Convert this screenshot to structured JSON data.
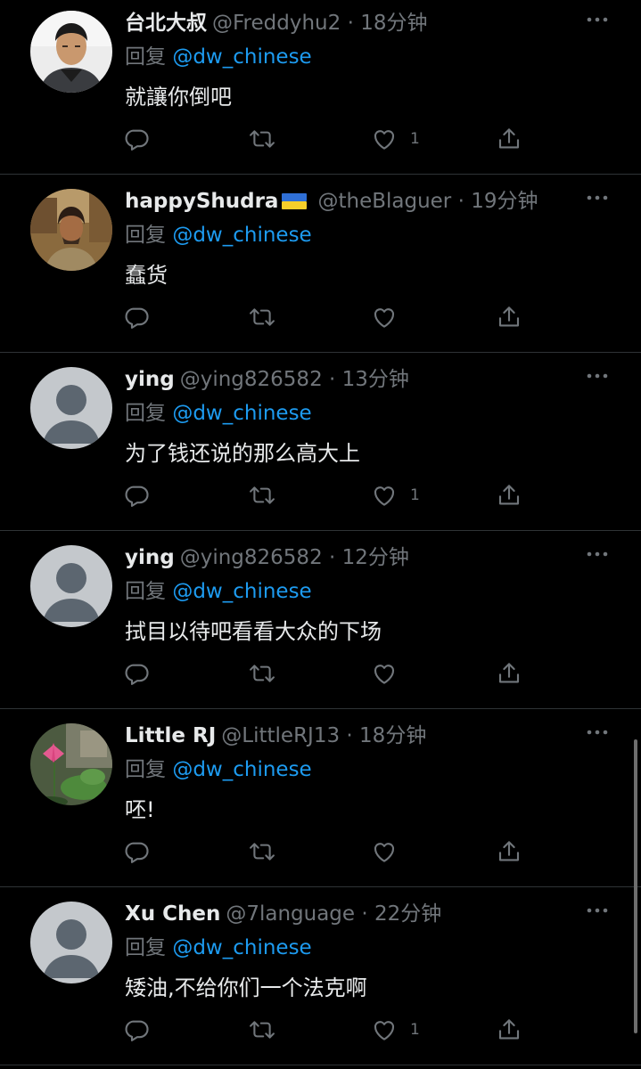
{
  "reply_prefix": "回复",
  "separator": "·",
  "tweets": [
    {
      "name": "台北大叔",
      "handle": "@Freddyhu2",
      "time": "18分钟",
      "mention": "@dw_chinese",
      "text": "就讓你倒吧",
      "likes": "1",
      "avatar": "photo-man"
    },
    {
      "name": "happyShudra",
      "handle": "@theBlaguer",
      "time": "19分钟",
      "mention": "@dw_chinese",
      "text": "蠢货",
      "likes": "",
      "avatar": "photo-man-outdoor",
      "flag": "ukraine-flag"
    },
    {
      "name": "ying",
      "handle": "@ying826582",
      "time": "13分钟",
      "mention": "@dw_chinese",
      "text": "为了钱还说的那么高大上",
      "likes": "1",
      "avatar": "default"
    },
    {
      "name": "ying",
      "handle": "@ying826582",
      "time": "12分钟",
      "mention": "@dw_chinese",
      "text": "拭目以待吧看看大众的下场",
      "likes": "",
      "avatar": "default"
    },
    {
      "name": "Little RJ",
      "handle": "@LittleRJ13",
      "time": "18分钟",
      "mention": "@dw_chinese",
      "text": "呸!",
      "likes": "",
      "avatar": "photo-lotus"
    },
    {
      "name": "Xu Chen",
      "handle": "@7language",
      "time": "22分钟",
      "mention": "@dw_chinese",
      "text": "矮油,不给你们一个法克啊",
      "likes": "1",
      "avatar": "default"
    }
  ],
  "colors": {
    "background": "#000000",
    "text": "#e7e9ea",
    "muted": "#71767b",
    "link": "#1d9bf0",
    "divider": "#2f3336"
  }
}
